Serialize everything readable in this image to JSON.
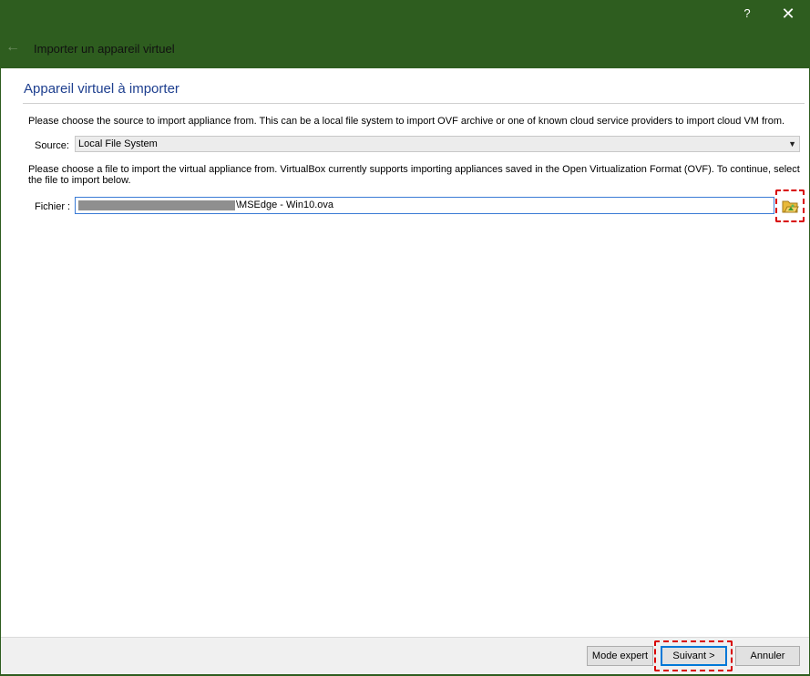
{
  "titlebar": {
    "help_label": "?",
    "close_label": "✕",
    "back_icon": "←",
    "title": "Importer un appareil virtuel"
  },
  "page": {
    "heading": "Appareil virtuel à importer",
    "source_description": "Please choose the source to import appliance from. This can be a local file system to import OVF archive or one of known cloud service providers to import cloud VM from.",
    "source_label": "Source:",
    "source_value": "Local File System",
    "file_description": "Please choose a file to import the virtual appliance from. VirtualBox currently supports importing appliances saved in the Open Virtualization Format (OVF). To continue, select the file to import below.",
    "file_label": "Fichier :",
    "file_value": "\\MSEdge - Win10.ova"
  },
  "buttons": {
    "expert": "Mode expert",
    "next": "Suivant >",
    "cancel": "Annuler"
  },
  "colors": {
    "titlebar_bg": "#2e5d1f",
    "heading": "#1e3f8f",
    "highlight": "#d80000"
  }
}
